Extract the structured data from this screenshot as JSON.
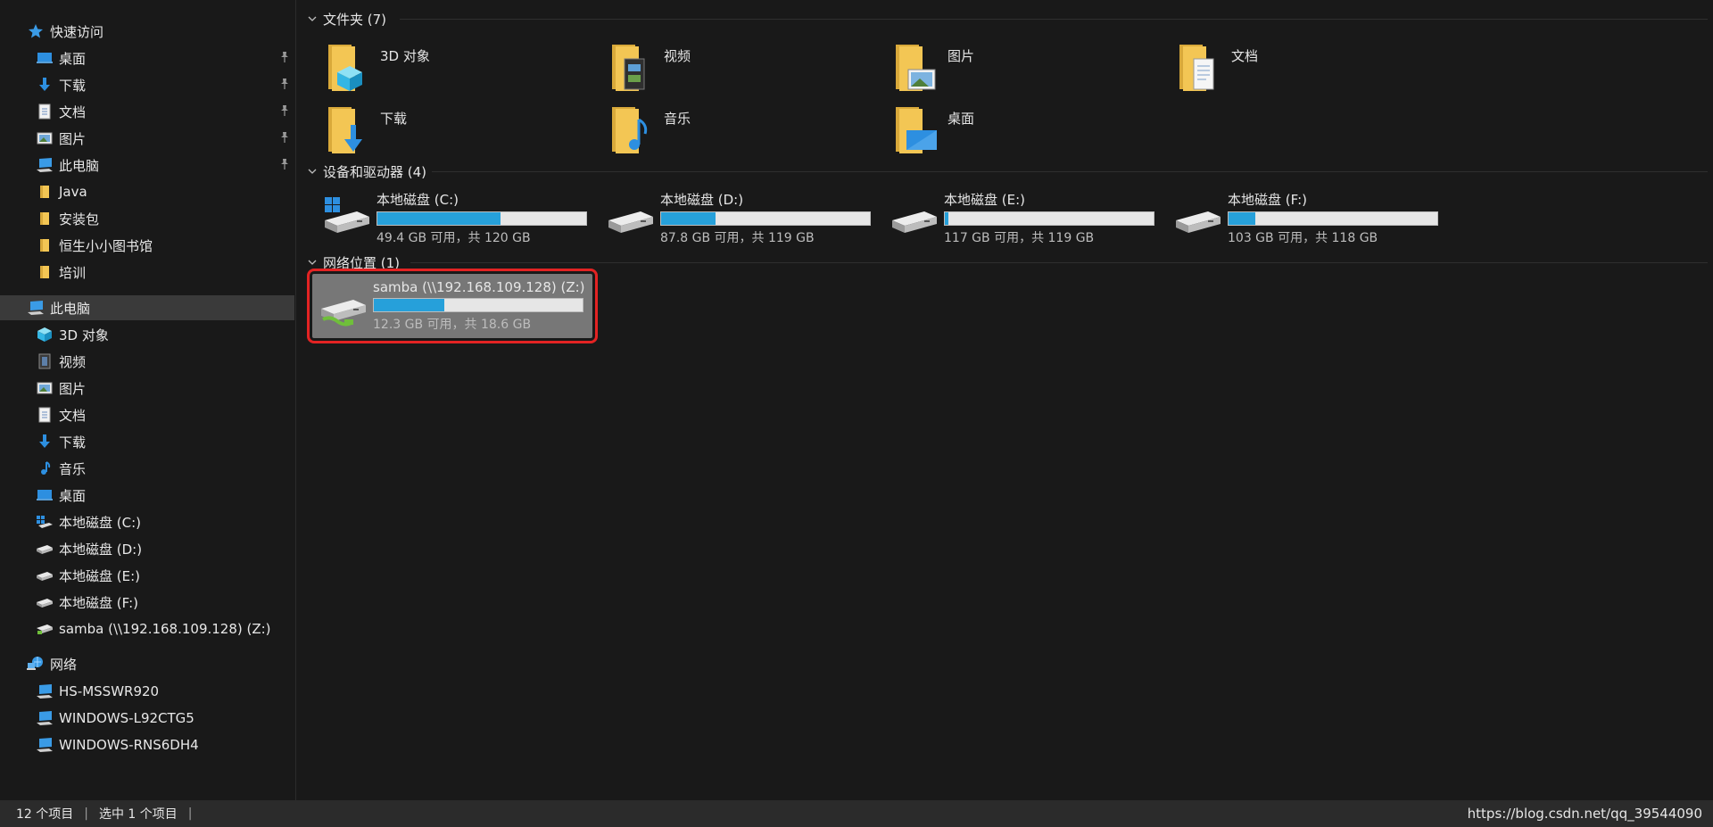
{
  "sidebar": {
    "quick_access": "快速访问",
    "quick_items": [
      {
        "label": "桌面",
        "icon": "desktop-icon",
        "pinned": true
      },
      {
        "label": "下载",
        "icon": "download-icon",
        "pinned": true
      },
      {
        "label": "文档",
        "icon": "document-icon",
        "pinned": true
      },
      {
        "label": "图片",
        "icon": "picture-icon",
        "pinned": true
      },
      {
        "label": "此电脑",
        "icon": "computer-icon",
        "pinned": true
      },
      {
        "label": "Java",
        "icon": "folder-icon",
        "pinned": false
      },
      {
        "label": "安装包",
        "icon": "folder-icon",
        "pinned": false
      },
      {
        "label": "恒生小小图书馆",
        "icon": "folder-icon",
        "pinned": false
      },
      {
        "label": "培训",
        "icon": "folder-icon",
        "pinned": false
      }
    ],
    "this_pc": "此电脑",
    "pc_items": [
      {
        "label": "3D 对象",
        "icon": "3d-objects-icon"
      },
      {
        "label": "视频",
        "icon": "video-icon"
      },
      {
        "label": "图片",
        "icon": "picture-icon"
      },
      {
        "label": "文档",
        "icon": "document-icon"
      },
      {
        "label": "下载",
        "icon": "download-icon"
      },
      {
        "label": "音乐",
        "icon": "music-icon"
      },
      {
        "label": "桌面",
        "icon": "desktop-icon"
      },
      {
        "label": "本地磁盘 (C:)",
        "icon": "system-drive-icon"
      },
      {
        "label": "本地磁盘 (D:)",
        "icon": "drive-icon"
      },
      {
        "label": "本地磁盘 (E:)",
        "icon": "drive-icon"
      },
      {
        "label": "本地磁盘 (F:)",
        "icon": "drive-icon"
      },
      {
        "label": "samba (\\\\192.168.109.128) (Z:)",
        "icon": "network-drive-icon"
      }
    ],
    "network": "网络",
    "network_items": [
      {
        "label": "HS-MSSWR920",
        "icon": "computer-icon"
      },
      {
        "label": "WINDOWS-L92CTG5",
        "icon": "computer-icon"
      },
      {
        "label": "WINDOWS-RNS6DH4",
        "icon": "computer-icon"
      }
    ]
  },
  "main": {
    "folders_header": "文件夹 (7)",
    "folders": [
      {
        "label": "3D 对象",
        "icon": "3d-objects-folder-icon"
      },
      {
        "label": "视频",
        "icon": "video-folder-icon"
      },
      {
        "label": "图片",
        "icon": "picture-folder-icon"
      },
      {
        "label": "文档",
        "icon": "document-folder-icon"
      },
      {
        "label": "下载",
        "icon": "download-folder-icon"
      },
      {
        "label": "音乐",
        "icon": "music-folder-icon"
      },
      {
        "label": "桌面",
        "icon": "desktop-folder-icon"
      }
    ],
    "drives_header": "设备和驱动器 (4)",
    "drives": [
      {
        "name": "本地磁盘 (C:)",
        "free": "49.4 GB 可用，共 120 GB",
        "used_fraction": 0.588,
        "icon": "system-drive-icon"
      },
      {
        "name": "本地磁盘 (D:)",
        "free": "87.8 GB 可用，共 119 GB",
        "used_fraction": 0.262,
        "icon": "drive-icon"
      },
      {
        "name": "本地磁盘 (E:)",
        "free": "117 GB 可用，共 119 GB",
        "used_fraction": 0.017,
        "icon": "drive-icon"
      },
      {
        "name": "本地磁盘 (F:)",
        "free": "103 GB 可用，共 118 GB",
        "used_fraction": 0.127,
        "icon": "drive-icon"
      }
    ],
    "network_header": "网络位置 (1)",
    "network_drives": [
      {
        "name": "samba (\\\\192.168.109.128) (Z:)",
        "free": "12.3 GB 可用，共 18.6 GB",
        "used_fraction": 0.339,
        "icon": "network-drive-icon"
      }
    ]
  },
  "status": {
    "count": "12 个项目",
    "selected": "选中 1 个项目",
    "sep": "|",
    "watermark": "https://blog.csdn.net/qq_39544090"
  },
  "colors": {
    "accent": "#26a0da",
    "highlight_border": "#e32323",
    "folder": "#f3c654"
  }
}
